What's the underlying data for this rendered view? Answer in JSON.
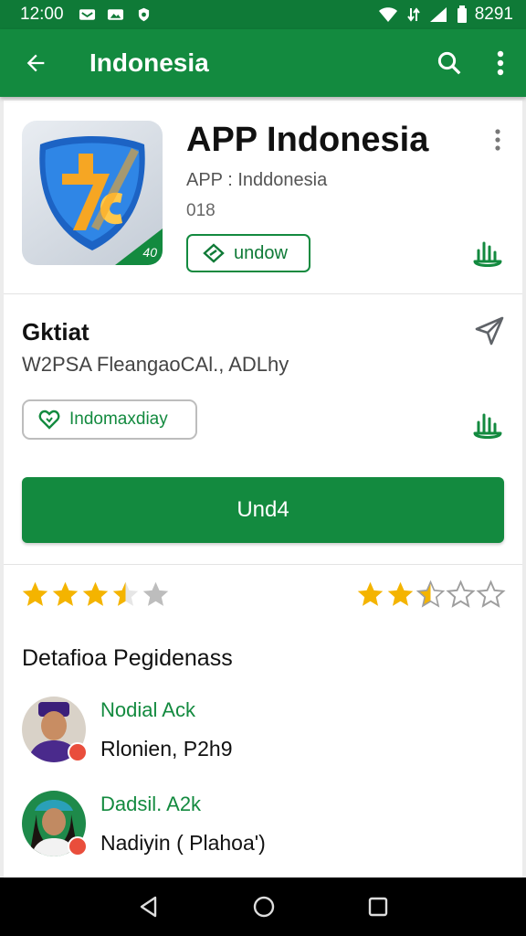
{
  "status_bar": {
    "time": "12:00",
    "battery": "8291"
  },
  "app_bar": {
    "title": "Indonesia"
  },
  "app_card": {
    "title": "APP Indonesia",
    "developer": "APP : Inddonesia",
    "size": "018",
    "icon_version": "40",
    "chip_label": "undow"
  },
  "detail_card": {
    "title": "Gktiat",
    "subtitle": "W2PSA FleangaoCAl., ADLhy",
    "chip_label": "Indomaxdiay",
    "primary_button": "Und4"
  },
  "ratings": {
    "left_stars": 3.5,
    "right_stars": 2.5,
    "max": 5
  },
  "section": {
    "title": "Detafioa Pegidenass"
  },
  "people": [
    {
      "name": "Nodial Ack",
      "desc": "Rlonien, P2h9"
    },
    {
      "name": "Dadsil. A2k",
      "desc": "Nadiyin ( Plahoa')"
    }
  ],
  "colors": {
    "primary": "#138a3f",
    "status_bar": "#0f7a37",
    "star_filled": "#f4b400",
    "star_empty": "#bdbdbd"
  }
}
